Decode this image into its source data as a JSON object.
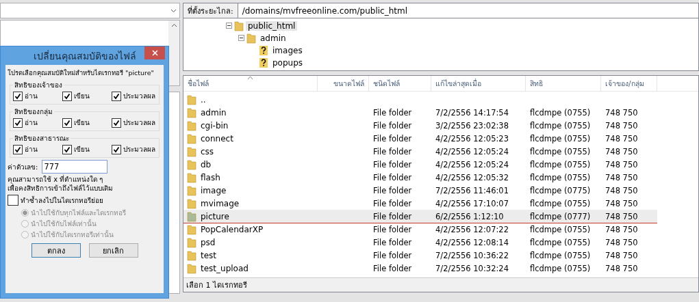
{
  "remote_site": {
    "label": "ที่ตั้งระยะไกล:",
    "path": "/domains/mvfreeonline.com/public_html"
  },
  "tree": [
    {
      "name": "public_html",
      "expanded": true,
      "selected": true,
      "kind": "folder",
      "children": [
        {
          "name": "admin",
          "expanded": true,
          "selected": false,
          "kind": "folder",
          "children": [
            {
              "name": "images",
              "selected": false,
              "kind": "unknown"
            },
            {
              "name": "popups",
              "selected": false,
              "kind": "unknown"
            }
          ]
        }
      ]
    }
  ],
  "file_list": {
    "columns": [
      {
        "label": "ชื่อไฟล์",
        "sorted": true
      },
      {
        "label": "ขนาดไฟล์",
        "sorted": false
      },
      {
        "label": "ชนิดไฟล์",
        "sorted": false
      },
      {
        "label": "แก้ไขล่าสุดเมื่อ",
        "sorted": false
      },
      {
        "label": "สิทธิ",
        "sorted": false
      },
      {
        "label": "เจ้าของ/กลุ่ม",
        "sorted": false
      }
    ],
    "rows": [
      {
        "name": "..",
        "selected": false
      },
      {
        "name": "admin",
        "type": "File folder",
        "modified": "7/2/2556 14:17:54",
        "permissions": "flcdmpe (0755)",
        "owner": "748 750",
        "selected": false
      },
      {
        "name": "cgi-bin",
        "type": "File folder",
        "modified": "3/2/2556 23:02:38",
        "permissions": "flcdmpe (0755)",
        "owner": "748 750",
        "selected": false
      },
      {
        "name": "connect",
        "type": "File folder",
        "modified": "4/2/2556 12:05:23",
        "permissions": "flcdmpe (0755)",
        "owner": "748 750",
        "selected": false
      },
      {
        "name": "css",
        "type": "File folder",
        "modified": "4/2/2556 12:05:24",
        "permissions": "flcdmpe (0755)",
        "owner": "748 750",
        "selected": false
      },
      {
        "name": "db",
        "type": "File folder",
        "modified": "4/2/2556 12:05:24",
        "permissions": "flcdmpe (0755)",
        "owner": "748 750",
        "selected": false
      },
      {
        "name": "flash",
        "type": "File folder",
        "modified": "4/2/2556 12:05:32",
        "permissions": "flcdmpe (0755)",
        "owner": "748 750",
        "selected": false
      },
      {
        "name": "image",
        "type": "File folder",
        "modified": "7/2/2556 11:46:01",
        "permissions": "flcdmpe (0775)",
        "owner": "748 750",
        "selected": false
      },
      {
        "name": "mvimage",
        "type": "File folder",
        "modified": "4/2/2556 17:10:07",
        "permissions": "flcdmpe (0755)",
        "owner": "748 750",
        "selected": false
      },
      {
        "name": "picture",
        "type": "File folder",
        "modified": "6/2/2556 1:12:10",
        "permissions": "flcdmpe (0777)",
        "owner": "748 750",
        "selected": true
      },
      {
        "name": "PopCalendarXP",
        "type": "File folder",
        "modified": "4/2/2556 12:07:22",
        "permissions": "flcdmpe (0755)",
        "owner": "748 750",
        "selected": false
      },
      {
        "name": "psd",
        "type": "File folder",
        "modified": "4/2/2556 12:08:14",
        "permissions": "flcdmpe (0755)",
        "owner": "748 750",
        "selected": false
      },
      {
        "name": "test",
        "type": "File folder",
        "modified": "7/2/2556 10:36:22",
        "permissions": "flcdmpe (0755)",
        "owner": "748 750",
        "selected": false
      },
      {
        "name": "test_upload",
        "type": "File folder",
        "modified": "7/2/2556 10:32:24",
        "permissions": "flcdmpe (0755)",
        "owner": "748 750",
        "selected": false
      }
    ],
    "status": "เลือก 1 ไดเรกทอรี"
  },
  "dialog": {
    "title": "เปลี่ยนคุณสมบัติของไฟล์",
    "prompt": "โปรดเลือกคุณสมบัติใหม่สำหรับไดเรกทอรี \"picture\"",
    "groups": [
      {
        "title": "สิทธิของเจ้าของ",
        "options": [
          {
            "label": "อ่าน",
            "checked": true
          },
          {
            "label": "เขียน",
            "checked": true
          },
          {
            "label": "ประมวลผล",
            "checked": true
          }
        ]
      },
      {
        "title": "สิทธิของกลุ่ม",
        "options": [
          {
            "label": "อ่าน",
            "checked": true
          },
          {
            "label": "เขียน",
            "checked": true
          },
          {
            "label": "ประมวลผล",
            "checked": true
          }
        ]
      },
      {
        "title": "สิทธิของสาธารณะ",
        "options": [
          {
            "label": "อ่าน",
            "checked": true
          },
          {
            "label": "เขียน",
            "checked": true
          },
          {
            "label": "ประมวลผล",
            "checked": true
          }
        ]
      }
    ],
    "numeric_label": "ค่าตัวเลข:",
    "numeric_value": "777",
    "note": "คุณสามารถใช้ x ที่ตำแหน่งใด ๆ\nเพื่อคงสิทธิการเข้าถึงไฟล์ไว้แบบเดิม",
    "recurse": {
      "label": "ทำซ้ำลงไปในไดเรกทอรีย่อย",
      "checked": false
    },
    "apply_options": [
      {
        "label": "นำไปใช้กับทุกไฟล์และไดเรกทอรี",
        "selected": true,
        "disabled": true
      },
      {
        "label": "นำไปใช้กับไฟล์เท่านั้น",
        "selected": false,
        "disabled": true
      },
      {
        "label": "นำไปใช้กับไดเรกทอรีเท่านั้น",
        "selected": false,
        "disabled": true
      }
    ],
    "buttons": [
      "ตกลง",
      "ยกเลิก"
    ]
  }
}
